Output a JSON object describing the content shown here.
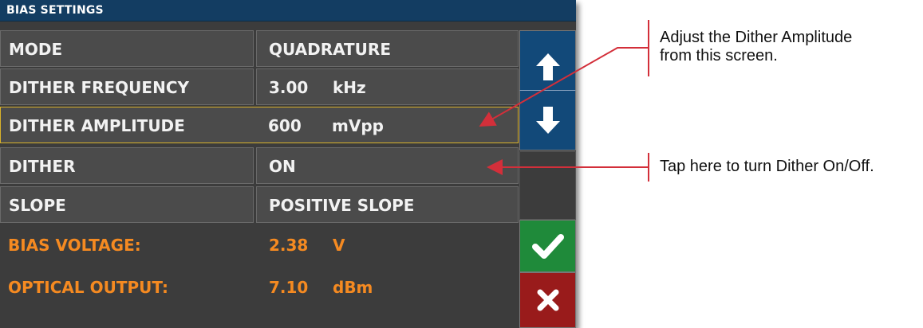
{
  "title": "BIAS SETTINGS",
  "settings": [
    {
      "label": "MODE",
      "value": "QUADRATURE",
      "unit": ""
    },
    {
      "label": "DITHER FREQUENCY",
      "value": "3.00",
      "unit": "kHz"
    },
    {
      "label": "DITHER AMPLITUDE",
      "value": "600",
      "unit": "mVpp"
    },
    {
      "label": "DITHER",
      "value": "ON",
      "unit": ""
    },
    {
      "label": "SLOPE",
      "value": "POSITIVE SLOPE",
      "unit": ""
    }
  ],
  "readouts": [
    {
      "label": "BIAS VOLTAGE:",
      "value": "2.38",
      "unit": "V"
    },
    {
      "label": "OPTICAL OUTPUT:",
      "value": "7.10",
      "unit": "dBm"
    }
  ],
  "buttons": {
    "up": "arrow-up-icon",
    "down": "arrow-down-icon",
    "ok": "checkmark-icon",
    "cancel": "close-icon"
  },
  "annotations": {
    "amplitude": "Adjust the Dither Amplitude from this screen.",
    "amplitude_line1": "Adjust the Dither Amplitude",
    "amplitude_line2": "from this screen.",
    "dither": "Tap here to turn Dither On/Off."
  },
  "colors": {
    "titlebar": "#133d62",
    "panel": "#3c3c3c",
    "cell": "#4b4b4b",
    "selected_border": "#d9b22a",
    "readout_text": "#f58a21",
    "nav_button": "#124979",
    "ok_button": "#1f8a3a",
    "cancel_button": "#991b1b",
    "callout_line": "#d32f3a"
  }
}
